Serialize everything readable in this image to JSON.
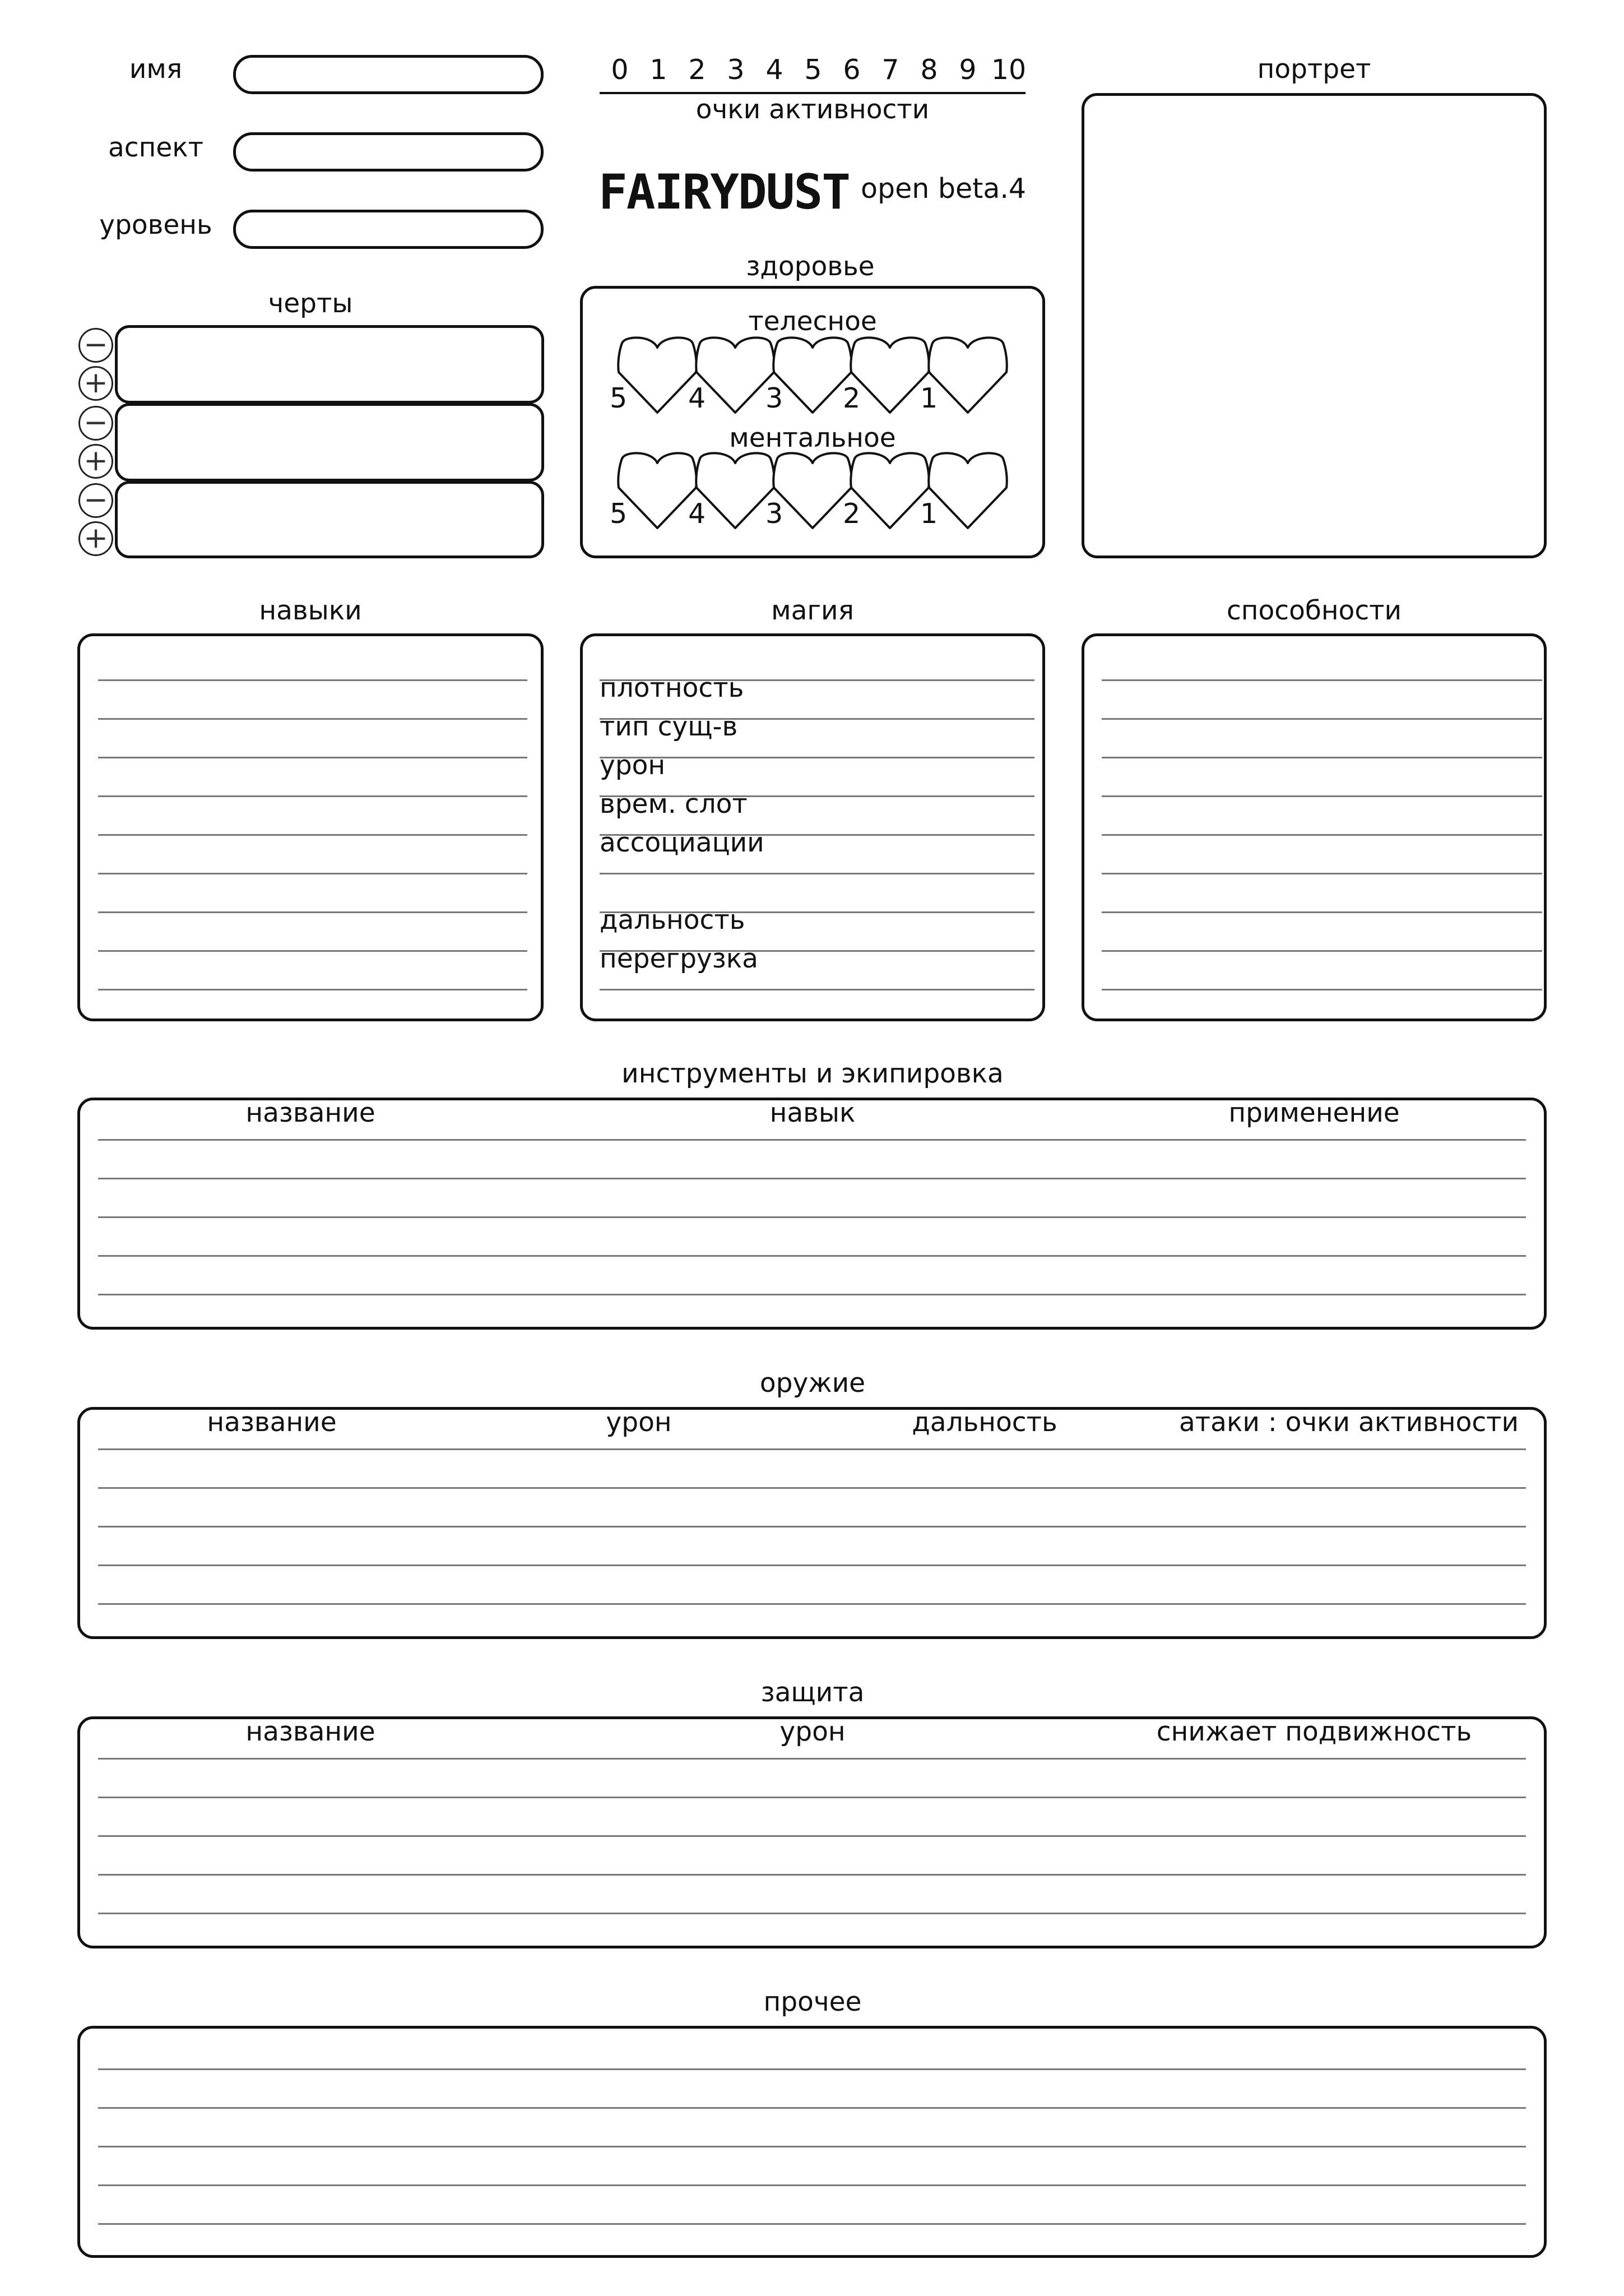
{
  "identity": {
    "name_label": "имя",
    "aspect_label": "аспект",
    "level_label": "уровень"
  },
  "traits": {
    "title": "черты",
    "minus": "−",
    "plus": "+"
  },
  "action_points": {
    "scale": [
      "0",
      "1",
      "2",
      "3",
      "4",
      "5",
      "6",
      "7",
      "8",
      "9",
      "10"
    ],
    "label": "очки активности"
  },
  "logo": {
    "text": "FAIRYDUST",
    "version": "open beta.4"
  },
  "health": {
    "title": "здоровье",
    "physical_label": "телесное",
    "mental_label": "ментальное",
    "numbers": [
      "5",
      "4",
      "3",
      "2",
      "1"
    ]
  },
  "portrait": {
    "title": "портрет"
  },
  "skills": {
    "title": "навыки"
  },
  "magic": {
    "title": "магия",
    "rows": [
      "плотность",
      "тип сущ-в",
      "урон",
      "врем. слот",
      "ассоциации",
      "",
      "дальность",
      "перегрузка"
    ]
  },
  "abilities": {
    "title": "способности"
  },
  "tools": {
    "title": "инструменты и экипировка",
    "columns": [
      "название",
      "навык",
      "применение"
    ]
  },
  "weapons": {
    "title": "оружие",
    "columns": [
      "название",
      "урон",
      "дальность",
      "атаки : очки активности"
    ]
  },
  "defense": {
    "title": "защита",
    "columns": [
      "название",
      "урон",
      "снижает подвижность"
    ]
  },
  "other": {
    "title": "прочее"
  }
}
